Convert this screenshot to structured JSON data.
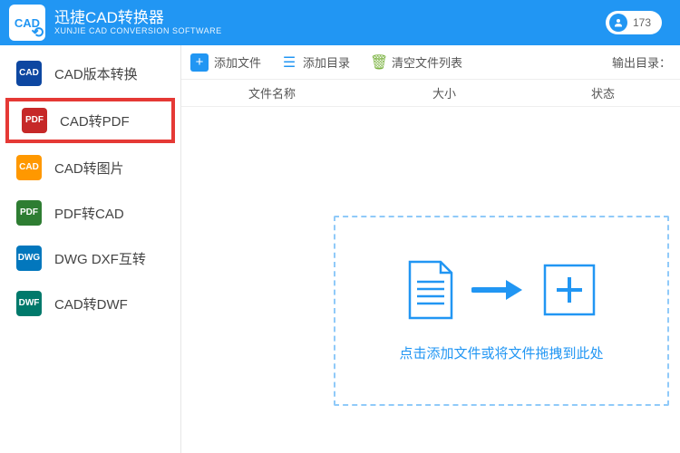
{
  "header": {
    "logo_text": "CAD",
    "title_cn": "迅捷CAD转换器",
    "title_en": "XUNJIE CAD CONVERSION SOFTWARE",
    "user_text": "173"
  },
  "sidebar": {
    "items": [
      {
        "label": "CAD版本转换",
        "icon_bg": "#0d47a1",
        "icon_text": "CAD"
      },
      {
        "label": "CAD转PDF",
        "icon_bg": "#c62828",
        "icon_text": "PDF",
        "highlighted": true
      },
      {
        "label": "CAD转图片",
        "icon_bg": "#ff9800",
        "icon_text": "CAD"
      },
      {
        "label": "PDF转CAD",
        "icon_bg": "#2e7d32",
        "icon_text": "PDF"
      },
      {
        "label": "DWG DXF互转",
        "icon_bg": "#0277bd",
        "icon_text": "DWG"
      },
      {
        "label": "CAD转DWF",
        "icon_bg": "#00796b",
        "icon_text": "DWF"
      }
    ]
  },
  "toolbar": {
    "add_file": "添加文件",
    "add_dir": "添加目录",
    "clear_list": "清空文件列表",
    "output_dir": "输出目录："
  },
  "columns": {
    "name": "文件名称",
    "size": "大小",
    "status": "状态"
  },
  "dropzone": {
    "text": "点击添加文件或将文件拖拽到此处"
  }
}
